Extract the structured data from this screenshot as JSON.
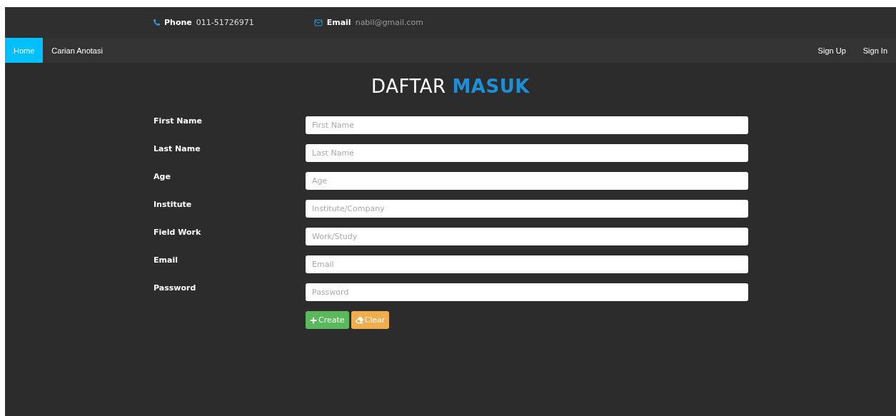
{
  "contact_bar": {
    "phone_label": "Phone",
    "phone": "011-51726971",
    "email_label": "Email",
    "email": "nabil@gmail.com"
  },
  "nav": {
    "items": [
      {
        "label": "Home",
        "selected": true
      },
      {
        "label": "Carian Anotasi",
        "selected": false
      }
    ],
    "right_items": [
      "Sign Up",
      "Sign In"
    ]
  },
  "title": {
    "plain": "DAFTAR",
    "accent": "MASUK"
  },
  "form": {
    "fields": [
      {
        "label": "First Name",
        "placeholder": "First Name"
      },
      {
        "label": "Last Name",
        "placeholder": "Last Name"
      },
      {
        "label": "Age",
        "placeholder": "Age"
      },
      {
        "label": "Institute",
        "placeholder": "Institute/Company"
      },
      {
        "label": "Field Work",
        "placeholder": "Work/Study"
      },
      {
        "label": "Email",
        "placeholder": "Email"
      },
      {
        "label": "Password",
        "placeholder": "Password"
      }
    ],
    "buttons": [
      {
        "label": "Create",
        "kind": "create"
      },
      {
        "label": "Clear",
        "kind": "clear"
      }
    ]
  }
}
